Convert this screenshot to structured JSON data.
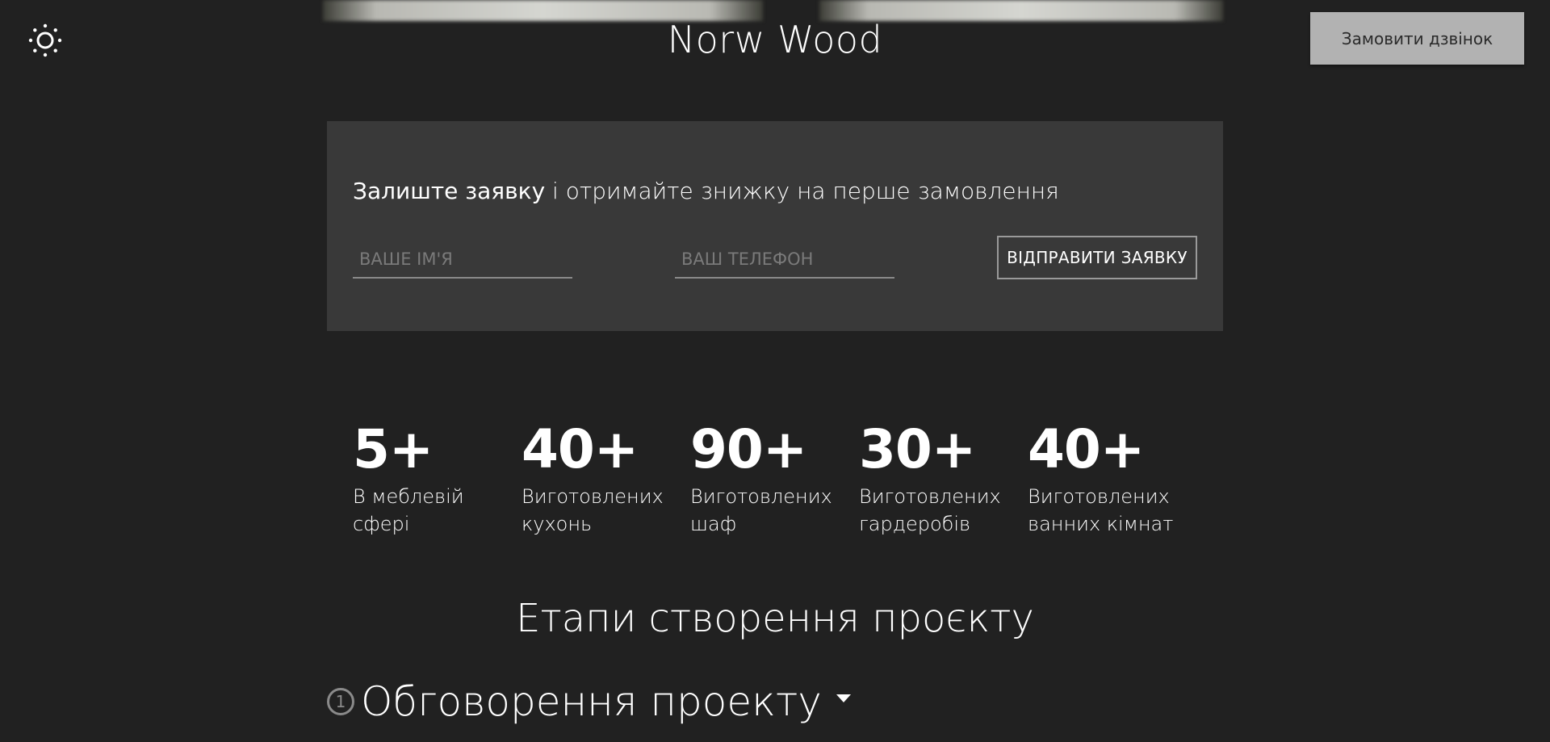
{
  "header": {
    "brand": "Norw Wood",
    "call_button": "Замовити дзвінок",
    "theme_icon": "sun-icon"
  },
  "lead_form": {
    "heading_strong": "Залиште заявку",
    "heading_rest": " і отримайте знижку на перше замовлення",
    "name_placeholder": "ВАШЕ ІМ'Я",
    "phone_placeholder": "ВАШ ТЕЛЕФОН",
    "submit_label": "ВІДПРАВИТИ ЗАЯВКУ"
  },
  "stats": [
    {
      "value": "5+",
      "label_line1": "В меблевій",
      "label_line2": "сфері"
    },
    {
      "value": "40+",
      "label_line1": "Виготовлених",
      "label_line2": "кухонь"
    },
    {
      "value": "90+",
      "label_line1": "Виготовлених",
      "label_line2": "шаф"
    },
    {
      "value": "30+",
      "label_line1": "Виготовлених",
      "label_line2": "гардеробів"
    },
    {
      "value": "40+",
      "label_line1": "Виготовлених",
      "label_line2": "ванних кімнат"
    }
  ],
  "stages": {
    "title": "Етапи створення проєкту",
    "items": [
      {
        "number": "1",
        "label": "Обговорення проекту"
      }
    ]
  },
  "colors": {
    "background": "#212121",
    "panel": "#393939",
    "call_button_bg": "#b2b2b2",
    "text": "#ffffff"
  }
}
